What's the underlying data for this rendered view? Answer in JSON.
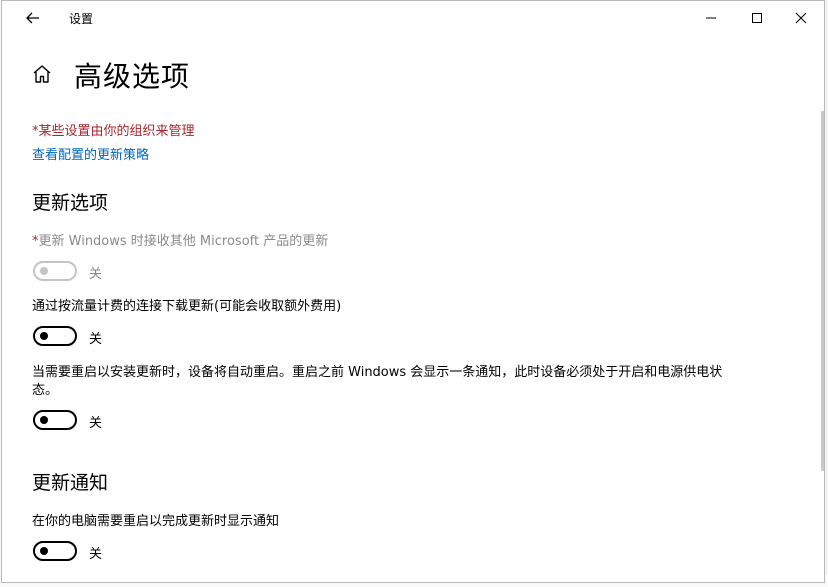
{
  "window": {
    "title": "设置"
  },
  "page": {
    "title": "高级选项"
  },
  "org_notice": "*某些设置由你的组织来管理",
  "policy_link": "查看配置的更新策略",
  "sections": {
    "update_options": {
      "heading": "更新选项",
      "other_products": {
        "required_mark": "*",
        "label": "更新 Windows 时接收其他 Microsoft 产品的更新",
        "state": "关",
        "enabled": false
      },
      "metered": {
        "label": "通过按流量计费的连接下载更新(可能会收取额外费用)",
        "state": "关"
      },
      "restart": {
        "label_line1": "当需要重启以安装更新时，设备将自动重启。重启之前 Windows 会显示一条通知，此时设备必须处于开启和电源供电状",
        "label_line2": "态。",
        "state": "关"
      }
    },
    "update_notifications": {
      "heading": "更新通知",
      "show_notification": {
        "label": "在你的电脑需要重启以完成更新时显示通知",
        "state": "关"
      }
    }
  },
  "icons": {
    "back": "arrow-left-icon",
    "home": "home-icon",
    "minimize": "minimize-icon",
    "maximize": "maximize-icon",
    "close": "close-icon"
  },
  "colors": {
    "accent_link": "#0067b8",
    "warning_red": "#a4262c",
    "disabled_gray": "#8a8a8a"
  }
}
